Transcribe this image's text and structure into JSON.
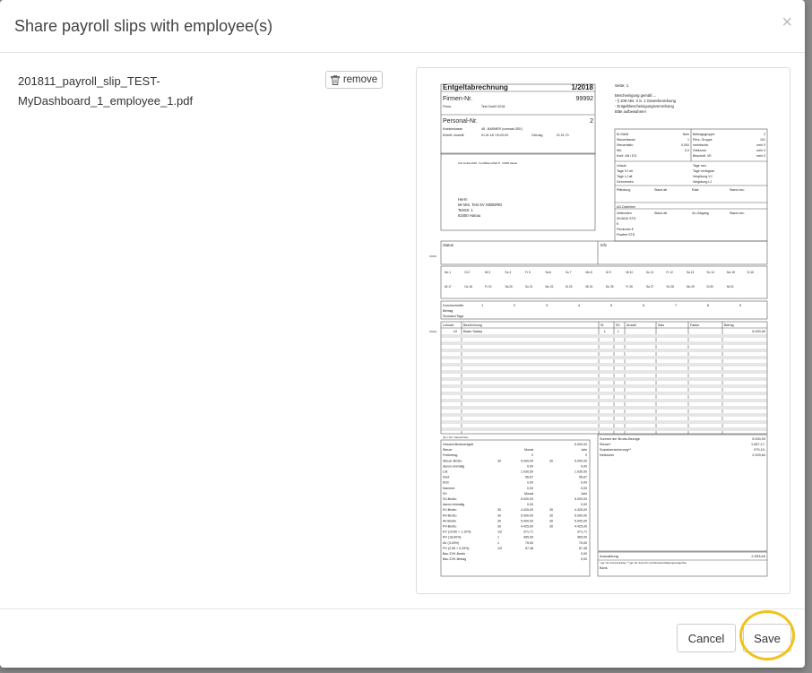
{
  "modal": {
    "title": "Share payroll slips with employee(s)",
    "close_label": "×"
  },
  "file": {
    "name_line1": "201811_payroll_slip_TEST-",
    "name_line2": "MyDashboard_1_employee_1.pdf",
    "remove_label": "remove"
  },
  "pdf": {
    "title": "Entgeltabrechnung",
    "period": "1/2018",
    "page_label": "Seite: 1",
    "company_label": "Firmen-Nr.",
    "company_nr": "99992",
    "firma_label": "Firma",
    "firma_value": "Test GmbH 2018",
    "personal_label": "Personal-Nr.",
    "personal_nr": "2",
    "kk_label": "Krankenkasse",
    "kk_value": "48 - BARMER (vormals GEK)",
    "eintritt_label": "Eintritt / Austritt",
    "eintritt_value": "01.01.18 / 00.00.00",
    "gebtag_label": "Geb.tag",
    "gebtag_value": "01.01.70",
    "notes": [
      "Bescheinigung gemäß ...",
      "- § 108 Abs. 3 S. 1 Gewerbeordnung",
      "- Entgeltbescheinigungsverordnung",
      "Bitte aufbewahren!"
    ],
    "address": [
      "Herrn",
      "Mr Mrs. Test SV Stk0DREI",
      "Teststr. 1",
      "63450 Hanau"
    ],
    "sender": "Test GmbH 2018 · Kurt-Blaum-Platz 8 · 63450 Hanau",
    "right_box": [
      [
        "ELStAM",
        "Nein"
      ],
      [
        "Steuerklasse",
        "1"
      ],
      [
        "Steuerfakto",
        "0,000"
      ],
      [
        "Kfb",
        "0,0"
      ],
      [
        "Konf. AN / EG",
        ""
      ]
    ],
    "right_box2": [
      [
        "Beitragsgruppe",
        "2"
      ],
      [
        "Pers.-Gruppe",
        "101"
      ],
      [
        "mehrfachb.",
        "nein 0"
      ],
      [
        "Gleitzone",
        "nein 0"
      ],
      [
        "Beschoft. VE",
        "nein 0"
      ]
    ],
    "urlaub_rows": [
      "Urlaub",
      "Tage VJ alt",
      "Tage LJ alt",
      "Genommen"
    ],
    "tage_rows": [
      "Tage neu",
      "Tage verfügbar",
      "Vergütung VJ",
      "Vergütung LJ"
    ],
    "pfaendung_header": [
      "Pfändung",
      "Stand alt",
      "Rate",
      "Stand neu"
    ],
    "ag_darlehen": "AG-Darlehen",
    "zk_header": [
      "Zeitkonten",
      "Stand alt",
      "Zu-/Abgang",
      "Stand neu"
    ],
    "zk_rows": [
      "ZK/AGK STD",
      "€",
      "Flexkonto €",
      "Postfrei STD"
    ],
    "status_label": "Status",
    "info_label": "Info",
    "days_row1": [
      "Mo 1",
      "Di 2",
      "Mi 3",
      "Do 4",
      "Fr 5",
      "Sa 6",
      "So 7",
      "Mo 8",
      "Di 9",
      "Mi 10",
      "Do 11",
      "Fr 12",
      "Sa 13",
      "So 14",
      "Mo 15",
      "Di 16"
    ],
    "days_row2": [
      "Mi 17",
      "Do 18",
      "Fr 19",
      "Sa 20",
      "So 21",
      "Mo 22",
      "Di 23",
      "Mi 24",
      "Do 25",
      "Fr 26",
      "Sa 27",
      "So 28",
      "Mo 29",
      "Di 30",
      "Mi 31"
    ],
    "avg_labels": [
      "Durchschnitte",
      "Betrag",
      "Stunden/Tage"
    ],
    "avg_nums": [
      "1",
      "2",
      "3",
      "4",
      "5",
      "6",
      "7",
      "8",
      "9"
    ],
    "wage_header": [
      "Lohnart",
      "Bezeichnung",
      "St",
      "SV",
      "Anzahl",
      "Satz",
      "Faktor",
      "Betrag"
    ],
    "wage_row": [
      "10",
      "Basic Salary",
      "L",
      "L",
      "",
      "",
      "",
      "5.000,00"
    ],
    "left_summary": [
      [
        "Gesamt-Bruttoentgelt",
        "",
        "",
        "",
        "5.000,00"
      ],
      [
        "Steuer",
        "",
        "Monat",
        "",
        "Jahr"
      ],
      [
        "Freibetrag",
        "",
        "0",
        "",
        "0"
      ],
      [
        "Steuer-Brutto",
        "30",
        "5.000,00",
        "30",
        "5.000,00"
      ],
      [
        "davon einmalig",
        "",
        "0,00",
        "",
        "0,00"
      ],
      [
        "LSt",
        "",
        "1.030,50",
        "",
        "1.030,50"
      ],
      [
        "SolZ",
        "",
        "56,67",
        "",
        "56,67"
      ],
      [
        "KiSt",
        "",
        "0,00",
        "",
        "0,00"
      ],
      [
        "Kammer",
        "",
        "0,00",
        "",
        "0,00"
      ],
      [
        "SV",
        "",
        "Monat",
        "",
        "Jahr"
      ],
      [
        "SV-Brutto",
        "",
        "5.000,00",
        "",
        "5.000,00"
      ],
      [
        "davon einmalig",
        "",
        "0,00",
        "",
        "0,00"
      ],
      [
        "KV-Brutto",
        "30",
        "4.425,00",
        "30",
        "4.425,00"
      ],
      [
        "RV-Brutto",
        "30",
        "5.000,00",
        "30",
        "5.000,00"
      ],
      [
        "AV-Brutto",
        "30",
        "5.000,00",
        "30",
        "5.000,00"
      ],
      [
        "PV-Brutto",
        "30",
        "4.425,00",
        "30",
        "4.425,00"
      ],
      [
        "KV (14,60 + 1,10%)",
        "1/Z",
        "371,71",
        "",
        "371,71"
      ],
      [
        "RV (18,60%)",
        "1",
        "465,00",
        "",
        "465,00"
      ],
      [
        "AV (3,00%)",
        "1",
        "75,00",
        "",
        "75,00"
      ],
      [
        "PV (2,55 + 0,25%)",
        "1/Z",
        "67,48",
        "",
        "67,48"
      ],
      [
        "Bau ZVK-Brutto",
        "",
        "",
        "",
        "0,00"
      ],
      [
        "Bau ZVK-Betrag",
        "",
        "",
        "",
        "0,00"
      ]
    ],
    "right_summary": [
      [
        "Summe der Brutto-Bezüge",
        "5.000,00"
      ],
      [
        "Steuer*",
        "1.087,17-"
      ],
      [
        "Sozialversicherung**",
        "979,19-"
      ],
      [
        "Nettolohn",
        "2.933,64"
      ]
    ],
    "payout_label": "Auszahlung",
    "payout_value": "2.933,64",
    "footnote": "* ggf. inkl. Kammerbeitrag / ** ggf. inkl. Sonst.SV und Winterbeschäftigungsumlage Bau",
    "bank_label": "Bank",
    "footnote_left": "(S) = SV / Steuerbrutto"
  },
  "footer": {
    "cancel_label": "Cancel",
    "save_label": "Save"
  }
}
